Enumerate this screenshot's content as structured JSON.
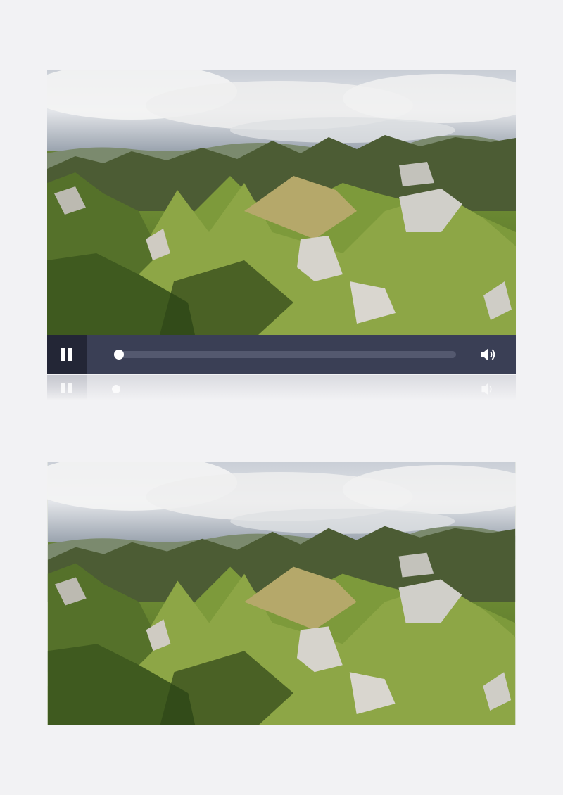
{
  "player": {
    "progress_fraction": 0.0,
    "pause_icon": "pause-icon",
    "volume_icon": "speaker-volume-icon"
  },
  "colors": {
    "page_background": "#f2f2f4",
    "control_bar": "#3a3f55",
    "pause_button_bg": "#232636",
    "progress_track": "#54596f",
    "progress_knob": "#ffffff"
  }
}
